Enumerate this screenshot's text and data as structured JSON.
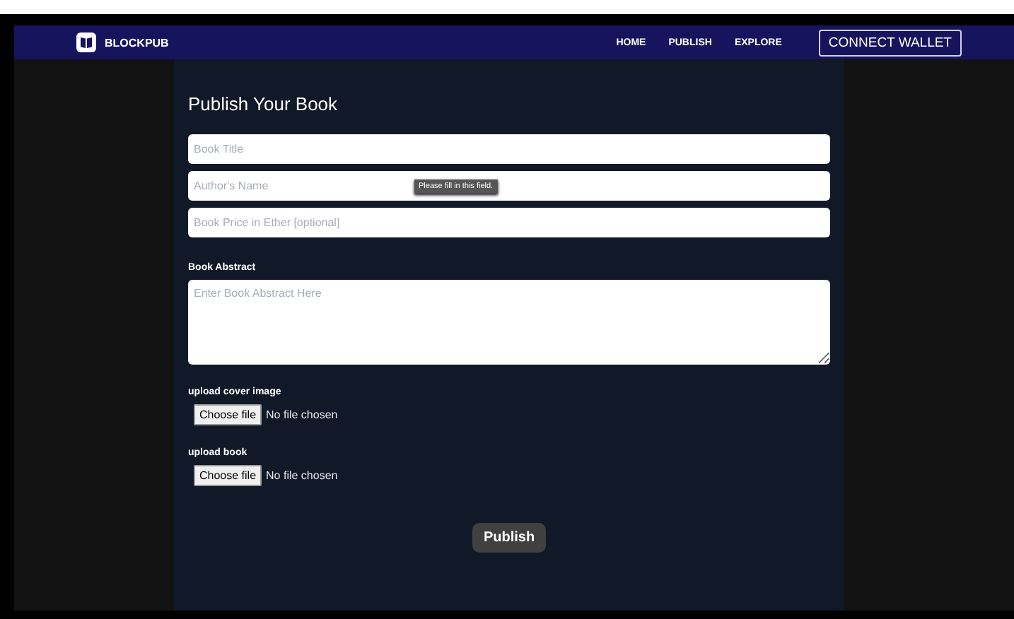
{
  "navbar": {
    "brand": "BLOCKPUB",
    "links": [
      {
        "label": "HOME"
      },
      {
        "label": "PUBLISH"
      },
      {
        "label": "EXPLORE"
      }
    ],
    "connect_button": "CONNECT WALLET"
  },
  "form": {
    "title": "Publish Your Book",
    "fields": [
      {
        "placeholder": "Book Title"
      },
      {
        "placeholder": "Author's Name"
      },
      {
        "placeholder": "Book Price in Ether [optional]"
      }
    ],
    "tooltip": "Please fill in this field.",
    "abstract": {
      "label": "Book Abstract",
      "placeholder": "Enter Book Abstract Here"
    },
    "uploads": [
      {
        "label": "upload cover image",
        "button": "Choose file",
        "status": "No file chosen"
      },
      {
        "label": "upload book",
        "button": "Choose file",
        "status": "No file chosen"
      }
    ],
    "submit": "Publish"
  }
}
